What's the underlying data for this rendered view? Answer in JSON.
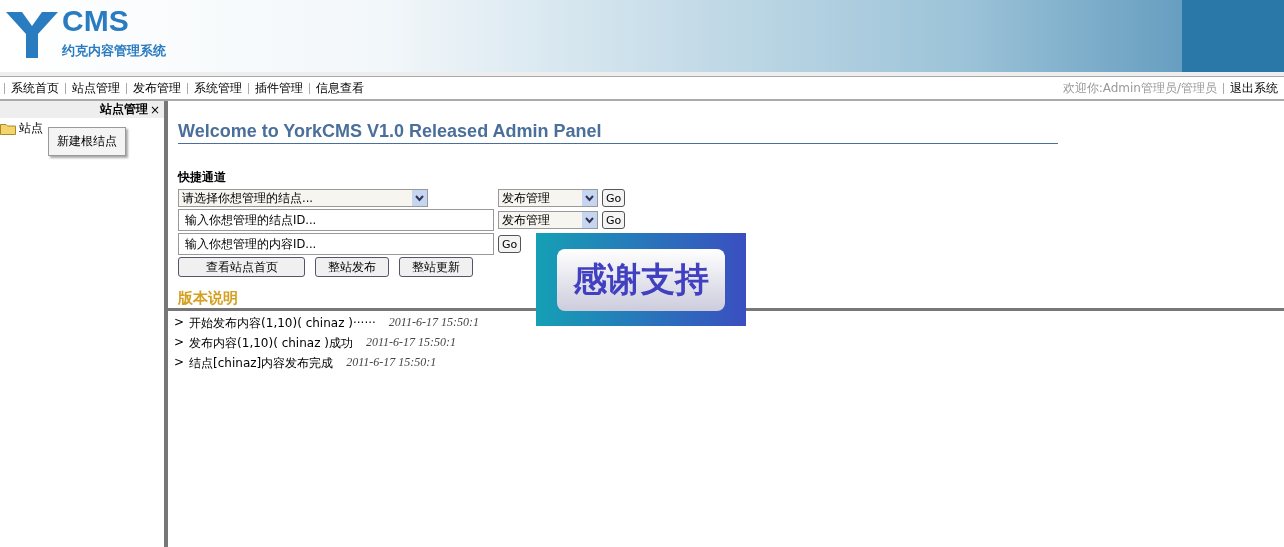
{
  "header": {
    "logo_text": "CMS",
    "logo_subtitle": "约克内容管理系统"
  },
  "nav": {
    "items": [
      {
        "label": "系统首页"
      },
      {
        "label": "站点管理"
      },
      {
        "label": "发布管理"
      },
      {
        "label": "系统管理"
      },
      {
        "label": "插件管理"
      },
      {
        "label": "信息查看"
      }
    ],
    "welcome": "欢迎你:Admin管理员/管理员",
    "logout": "退出系统"
  },
  "sidebar": {
    "title": "站点管理",
    "close": "×",
    "tree": [
      {
        "label": "站点"
      }
    ],
    "context_menu": [
      "新建根结点"
    ]
  },
  "main": {
    "title": "Welcome to YorkCMS V1.0 Released Admin Panel",
    "quick_title": "快捷通道",
    "node_select": {
      "value": "请选择你想管理的结点..."
    },
    "action_select_1": {
      "value": "发布管理"
    },
    "go_1": "Go",
    "node_id_field": {
      "value": "输入你想管理的结点ID..."
    },
    "action_select_2": {
      "value": "发布管理"
    },
    "go_2": "Go",
    "content_id_field": {
      "value": "输入你想管理的内容ID..."
    },
    "go_3": "Go",
    "buttons": [
      "查看站点首页",
      "整站发布",
      "整站更新"
    ],
    "banner": "感谢支持",
    "version_title": "版本说明",
    "log": [
      {
        "marker": ">",
        "text": "开始发布内容(1,10)( chinaz )······",
        "time": "2011-6-17 15:50:1"
      },
      {
        "marker": ">",
        "text": "发布内容(1,10)( chinaz )成功",
        "time": "2011-6-17 15:50:1"
      },
      {
        "marker": ">",
        "text": "结点[chinaz]内容发布完成",
        "time": "2011-6-17 15:50:1"
      }
    ]
  }
}
